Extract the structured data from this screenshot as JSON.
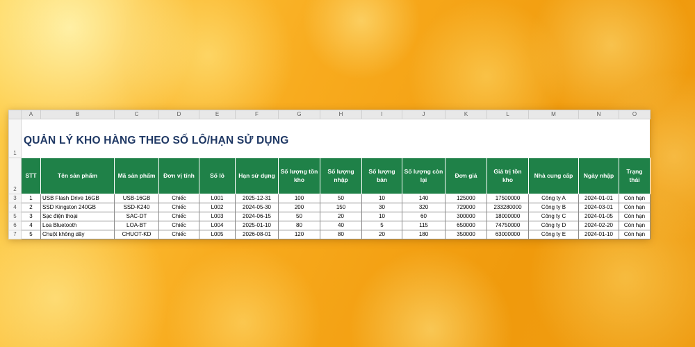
{
  "sheet": {
    "title": "QUẢN LÝ KHO HÀNG THEO SỐ LÔ/HẠN SỬ DỤNG",
    "column_letters": [
      "A",
      "B",
      "C",
      "D",
      "E",
      "F",
      "G",
      "H",
      "I",
      "J",
      "K",
      "L",
      "M",
      "N",
      "O"
    ],
    "row_numbers": [
      "1",
      "2",
      "3",
      "4",
      "5",
      "6",
      "7"
    ],
    "colors": {
      "header_bg": "#1F8148",
      "header_text": "#FFFFFF",
      "title_color": "#1F3864"
    },
    "table": {
      "headers": [
        "STT",
        "Tên sản phẩm",
        "Mã sản phẩm",
        "Đơn vị tính",
        "Số lô",
        "Hạn sử dụng",
        "Số lượng tồn kho",
        "Số lượng nhập",
        "Số lượng bán",
        "Số lượng còn lại",
        "Đơn giá",
        "Giá trị tồn kho",
        "Nhà cung cấp",
        "Ngày nhập",
        "Trạng thái"
      ],
      "rows": [
        [
          "1",
          "USB Flash Drive 16GB",
          "USB-16GB",
          "Chiếc",
          "L001",
          "2025-12-31",
          "100",
          "50",
          "10",
          "140",
          "125000",
          "17500000",
          "Công ty A",
          "2024-01-01",
          "Còn hạn"
        ],
        [
          "2",
          "SSD Kingston 240GB",
          "SSD-K240",
          "Chiếc",
          "L002",
          "2024-05-30",
          "200",
          "150",
          "30",
          "320",
          "729000",
          "233280000",
          "Công ty B",
          "2024-03-01",
          "Còn hạn"
        ],
        [
          "3",
          "Sạc điện thoại",
          "SAC-DT",
          "Chiếc",
          "L003",
          "2024-06-15",
          "50",
          "20",
          "10",
          "60",
          "300000",
          "18000000",
          "Công ty C",
          "2024-01-05",
          "Còn hạn"
        ],
        [
          "4",
          "Loa Bluetooth",
          "LOA-BT",
          "Chiếc",
          "L004",
          "2025-01-10",
          "80",
          "40",
          "5",
          "115",
          "650000",
          "74750000",
          "Công ty D",
          "2024-02-20",
          "Còn hạn"
        ],
        [
          "5",
          "Chuột không dây",
          "CHUOT-KD",
          "Chiếc",
          "L005",
          "2026-08-01",
          "120",
          "80",
          "20",
          "180",
          "350000",
          "63000000",
          "Công ty E",
          "2024-01-10",
          "Còn hạn"
        ]
      ]
    }
  }
}
